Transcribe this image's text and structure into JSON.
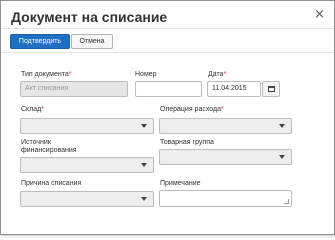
{
  "dialog": {
    "title": "Документ на списание",
    "close_glyph": "×"
  },
  "toolbar": {
    "confirm_label": "Подтвердить",
    "cancel_label": "Отмена"
  },
  "form": {
    "doc_type": {
      "label": "Тип документа",
      "required_mark": "*",
      "value": "Акт списания"
    },
    "number": {
      "label": "Номер",
      "value": ""
    },
    "date": {
      "label": "Дата",
      "required_mark": "*",
      "value": "11.04.2015",
      "button_icon": "calendar-icon"
    },
    "warehouse": {
      "label": "Склад",
      "required_mark": "*",
      "value": ""
    },
    "operation": {
      "label": "Операция расхода",
      "required_mark": "*",
      "value": ""
    },
    "funding_source": {
      "label_line1": "Источник",
      "label_line2": "финансирования",
      "value": ""
    },
    "product_group": {
      "label": "Товарная группа",
      "value": ""
    },
    "writeoff_reason": {
      "label": "Причина списания",
      "value": ""
    },
    "note": {
      "label": "Примечание",
      "value": ""
    }
  },
  "colors": {
    "primary_button": "#1f6fc5",
    "required_mark": "#c9302c"
  }
}
